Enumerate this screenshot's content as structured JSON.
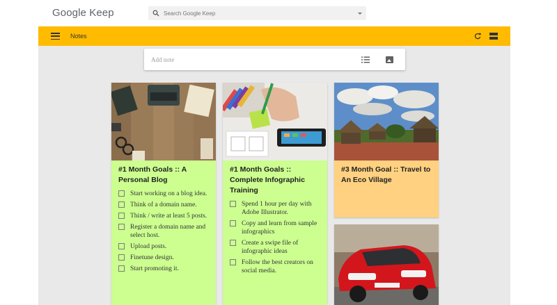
{
  "app": {
    "logo": "Google Keep"
  },
  "search": {
    "placeholder": "Search Google Keep"
  },
  "toolbar": {
    "title": "Notes"
  },
  "add_note": {
    "placeholder": "Add note"
  },
  "notes": [
    {
      "title": "#1 Month Goals :: A Personal Blog",
      "color": "#ccff90",
      "image": "desk-typewriter-photo",
      "items": [
        "Start working on a blog idea.",
        "Think of a domain name.",
        "Think / write at least 5 posts.",
        "Register a domain name and select host.",
        "Upload posts.",
        "Finetune design.",
        "Start promoting it."
      ]
    },
    {
      "title": "#1 Month Goals :: Complete Infographic Training",
      "color": "#ccff90",
      "image": "hand-sketching-phone-photo",
      "items": [
        "Spend 1 hour per day with Adobe Illustrator.",
        "Copy and learn from sample infographics",
        "Create a swipe file of infographic ideas",
        "Follow the best creators on social media."
      ]
    },
    {
      "title": "#3 Month Goal :: Travel to An Eco Village",
      "color": "#ffd180",
      "image": "eco-village-huts-photo",
      "items": []
    },
    {
      "title": "",
      "color": "#ffffff",
      "image": "red-car-photo",
      "items": []
    }
  ],
  "colors": {
    "toolbar": "#ffbb00",
    "green_note": "#ccff90",
    "orange_note": "#ffd180",
    "background": "#e9e9e9"
  },
  "icons": [
    "search-icon",
    "caret-down-icon",
    "menu-icon",
    "refresh-icon",
    "list-view-icon",
    "checklist-icon",
    "image-icon"
  ]
}
